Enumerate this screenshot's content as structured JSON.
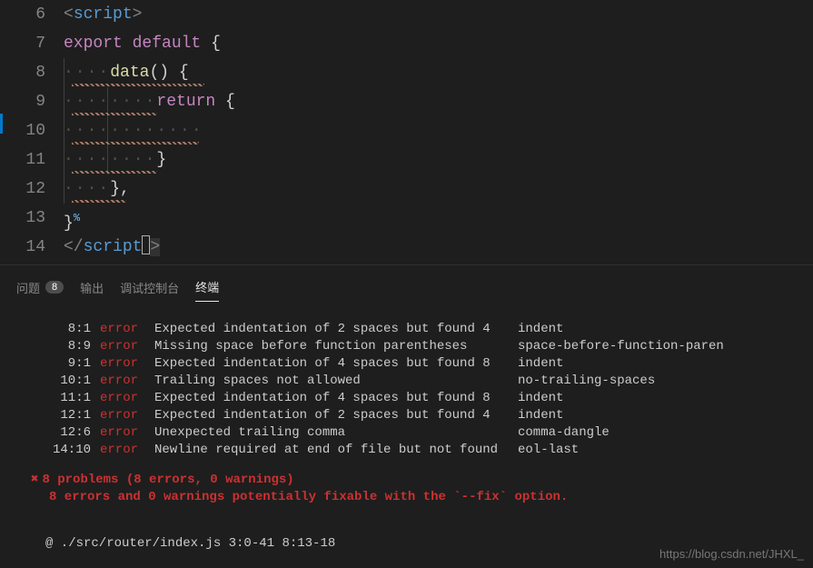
{
  "editor": {
    "lines": {
      "6": {
        "num": "6"
      },
      "7": {
        "num": "7"
      },
      "8": {
        "num": "8"
      },
      "9": {
        "num": "9"
      },
      "10": {
        "num": "10"
      },
      "11": {
        "num": "11"
      },
      "12": {
        "num": "12"
      },
      "13": {
        "num": "13"
      },
      "14": {
        "num": "14"
      }
    },
    "tokens": {
      "script_open_lt": "<",
      "script_open_name": "script",
      "script_open_gt": ">",
      "export": "export",
      "default": "default",
      "brace_open": "{",
      "data": "data",
      "parens": "()",
      "return": "return",
      "brace_close": "}",
      "brace_close_comma": "},",
      "script_close_lt": "</",
      "script_close_name": "script",
      "script_close_gt": ">"
    },
    "whitespace": {
      "dots4": "····",
      "dots8": "········",
      "dots12": "············"
    }
  },
  "panel": {
    "tabs": {
      "problems": "问题",
      "problems_count": "8",
      "output": "输出",
      "debug": "调试控制台",
      "terminal": "终端"
    }
  },
  "lint": {
    "rows": [
      {
        "loc": "8:1",
        "level": "error",
        "msg": "Expected indentation of 2 spaces but found 4",
        "rule": "indent"
      },
      {
        "loc": "8:9",
        "level": "error",
        "msg": "Missing space before function parentheses",
        "rule": "space-before-function-paren"
      },
      {
        "loc": "9:1",
        "level": "error",
        "msg": "Expected indentation of 4 spaces but found 8",
        "rule": "indent"
      },
      {
        "loc": "10:1",
        "level": "error",
        "msg": "Trailing spaces not allowed",
        "rule": "no-trailing-spaces"
      },
      {
        "loc": "11:1",
        "level": "error",
        "msg": "Expected indentation of 4 spaces but found 8",
        "rule": "indent"
      },
      {
        "loc": "12:1",
        "level": "error",
        "msg": "Expected indentation of 2 spaces but found 4",
        "rule": "indent"
      },
      {
        "loc": "12:6",
        "level": "error",
        "msg": "Unexpected trailing comma",
        "rule": "comma-dangle"
      },
      {
        "loc": "14:10",
        "level": "error",
        "msg": "Newline required at end of file but not found",
        "rule": "eol-last"
      }
    ],
    "summary1": "8 problems (8 errors, 0 warnings)",
    "summary2": "8 errors and 0 warnings potentially fixable with the `--fix` option.",
    "footer": "@ ./src/router/index.js 3:0-41 8:13-18"
  },
  "watermark": "https://blog.csdn.net/JHXL_"
}
